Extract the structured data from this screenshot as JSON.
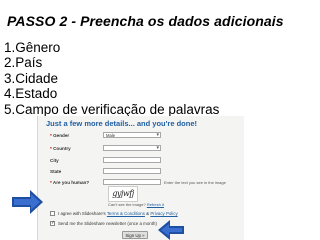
{
  "slide": {
    "title": "PASSO 2 - Preencha os dados adicionais",
    "steps": [
      "1.Gênero",
      "2.País",
      "3.Cidade",
      "4.Estado",
      "5.Campo de verificação de palavras"
    ]
  },
  "form": {
    "heading": "Just a few more details... and you're done!",
    "gender_label": "Gender",
    "gender_value": "Male",
    "country_label": "Country",
    "city_label": "City",
    "state_label": "State",
    "human_label": "Are you human?",
    "human_hint": "Enter the text you see in the image",
    "captcha_text": "gyjwfj",
    "captcha_help": "Can't see the image?",
    "captcha_help_link": "Refresh it",
    "agree_text": "I agree with Slideshare's",
    "terms_link": "Terms & Conditions",
    "and_text": "&",
    "privacy_link": "Privacy Policy",
    "newsletter_text": "Send me the Slideshare newsletter (once a month)",
    "signup_label": "Sign Up »"
  },
  "colors": {
    "heading": "#1f5fa3",
    "arrow": "#1f4fa3",
    "required_star": "#cc0000"
  }
}
